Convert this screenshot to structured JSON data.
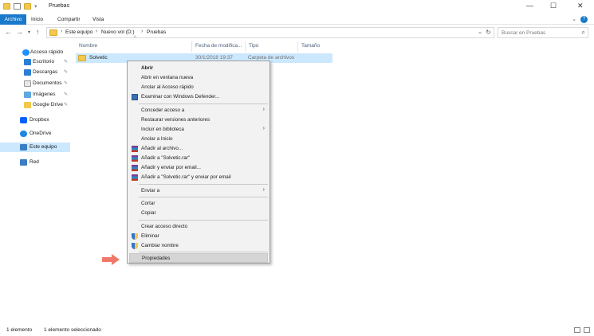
{
  "window": {
    "title": "Pruebas",
    "controls": {
      "minimize": "—",
      "maximize": "☐",
      "close": "✕"
    }
  },
  "ribbon": {
    "tabs": [
      "Archivo",
      "Inicio",
      "Compartir",
      "Vista"
    ],
    "file_tab_color": "#1979ca"
  },
  "address": {
    "breadcrumb": [
      "Este equipo",
      "Nuevo vol (D:)",
      "Pruebas"
    ],
    "search_placeholder": "Buscar en Pruebas"
  },
  "nav": {
    "items": [
      {
        "label": "Acceso rápido",
        "icon": "star-icon"
      },
      {
        "label": "Escritorio",
        "icon": "desktop-icon",
        "pinned": true
      },
      {
        "label": "Descargas",
        "icon": "download-icon",
        "pinned": true
      },
      {
        "label": "Documentos",
        "icon": "documents-icon",
        "pinned": true
      },
      {
        "label": "Imágenes",
        "icon": "pictures-icon",
        "pinned": true
      },
      {
        "label": "Google Drive",
        "icon": "folder-icon",
        "pinned": true
      },
      {
        "label": "Dropbox",
        "icon": "dropbox-icon"
      },
      {
        "label": "OneDrive",
        "icon": "onedrive-icon"
      },
      {
        "label": "Este equipo",
        "icon": "pc-icon",
        "selected": true
      },
      {
        "label": "Red",
        "icon": "network-icon"
      }
    ]
  },
  "columns": [
    "Nombre",
    "Fecha de modifica...",
    "Tipo",
    "Tamaño"
  ],
  "files": [
    {
      "name": "Solvetic",
      "date": "30/1/2018 19:37",
      "type": "Carpeta de archivos",
      "size": ""
    }
  ],
  "context_menu": {
    "items": [
      {
        "label": "Abrir",
        "bold": true
      },
      {
        "label": "Abrir en ventana nueva"
      },
      {
        "label": "Anclar al Acceso rápido"
      },
      {
        "label": "Examinar con Windows Defender...",
        "icon": "defender-icon"
      },
      {
        "label": "Conceder acceso a",
        "submenu": true
      },
      {
        "label": "Restaurar versiones anteriores"
      },
      {
        "label": "Incluir en biblioteca",
        "submenu": true
      },
      {
        "label": "Anclar a Inicio"
      },
      {
        "label": "Añadir al archivo...",
        "icon": "winrar-icon"
      },
      {
        "label": "Añadir a \"Solvetic.rar\"",
        "icon": "winrar-icon"
      },
      {
        "label": "Añadir y enviar por email...",
        "icon": "winrar-icon"
      },
      {
        "label": "Añadir a \"Solvetic.rar\" y enviar por email",
        "icon": "winrar-icon"
      },
      {
        "label": "Enviar a",
        "submenu": true
      },
      {
        "label": "Cortar"
      },
      {
        "label": "Copiar"
      },
      {
        "label": "Crear acceso directo"
      },
      {
        "label": "Eliminar",
        "icon": "shield-icon"
      },
      {
        "label": "Cambiar nombre",
        "icon": "shield-icon"
      },
      {
        "label": "Propiedades",
        "highlighted": true
      }
    ]
  },
  "status": {
    "count": "1 elemento",
    "selected": "1 elemento seleccionado"
  },
  "colors": {
    "selection": "#cce8ff",
    "pointer": "#f07868"
  }
}
